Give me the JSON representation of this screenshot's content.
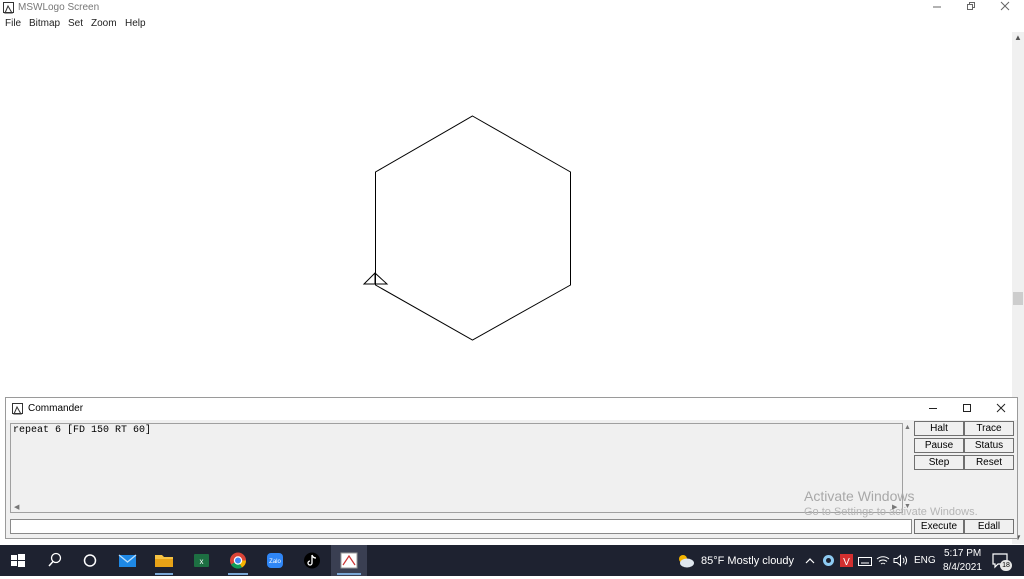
{
  "window": {
    "title": "MSWLogo Screen",
    "controls": [
      "minimize",
      "restore",
      "close"
    ]
  },
  "menu": [
    "File",
    "Bitmap",
    "Set",
    "Zoom",
    "Help"
  ],
  "drawing": {
    "shape": "hexagon",
    "turtle": "triangle-turtle",
    "line_color": "#000000"
  },
  "commander": {
    "title": "Commander",
    "history": "repeat 6 [FD 150 RT 60]",
    "input_value": "",
    "buttons": {
      "halt": "Halt",
      "trace": "Trace",
      "pause": "Pause",
      "status": "Status",
      "step": "Step",
      "reset": "Reset",
      "execute": "Execute",
      "edall": "Edall"
    }
  },
  "watermark": {
    "line1": "Activate Windows",
    "line2": "Go to Settings to activate Windows."
  },
  "taskbar": {
    "apps": [
      "windows-start-icon",
      "search-icon",
      "task-view-icon",
      "mail-icon",
      "file-explorer-icon",
      "excel-icon",
      "chrome-icon",
      "zalo-icon",
      "tiktok-icon",
      "mswlogo-icon"
    ],
    "weather": "85°F  Mostly cloudy",
    "language": "ENG",
    "time": "5:17 PM",
    "date": "8/4/2021",
    "notification_count": "18"
  },
  "colors": {
    "taskbar_bg": "#1e2230",
    "panel_bg": "#f0f0f0",
    "accent": "#0078d7"
  }
}
